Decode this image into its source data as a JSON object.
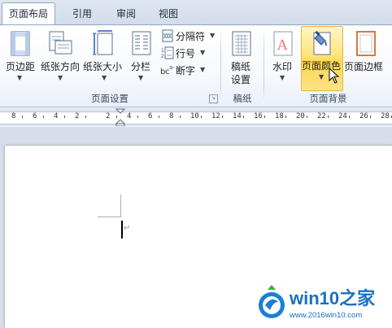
{
  "tabs": [
    {
      "label": "页面布局",
      "active": true
    },
    {
      "label": "引用",
      "active": false
    },
    {
      "label": "审阅",
      "active": false
    },
    {
      "label": "视图",
      "active": false
    }
  ],
  "groups": {
    "page_setup": {
      "label": "页面设置",
      "margins": "页边距",
      "orientation": "纸张方向",
      "size": "纸张大小",
      "columns": "分栏",
      "breaks": "分隔符",
      "line_numbers": "行号",
      "hyphenation": "断字"
    },
    "draft": {
      "label": "稿纸",
      "draft_settings_line1": "稿纸",
      "draft_settings_line2": "设置"
    },
    "page_background": {
      "label": "页面背景",
      "watermark": "水印",
      "page_color": "页面颜色",
      "page_borders": "页面边框"
    }
  },
  "ruler": {
    "numbers": [
      "8",
      "6",
      "4",
      "2",
      "2",
      "4",
      "6",
      "8",
      "10",
      "12",
      "14",
      "16",
      "18",
      "20",
      "22",
      "24",
      "26",
      "28"
    ]
  },
  "watermark": {
    "brand": "win10之家",
    "url": "www.2016win10.com"
  },
  "colors": {
    "accent_tab": "#1e5fae",
    "highlight": "#ffd84a",
    "ribbon_border": "#8ea6c4"
  }
}
